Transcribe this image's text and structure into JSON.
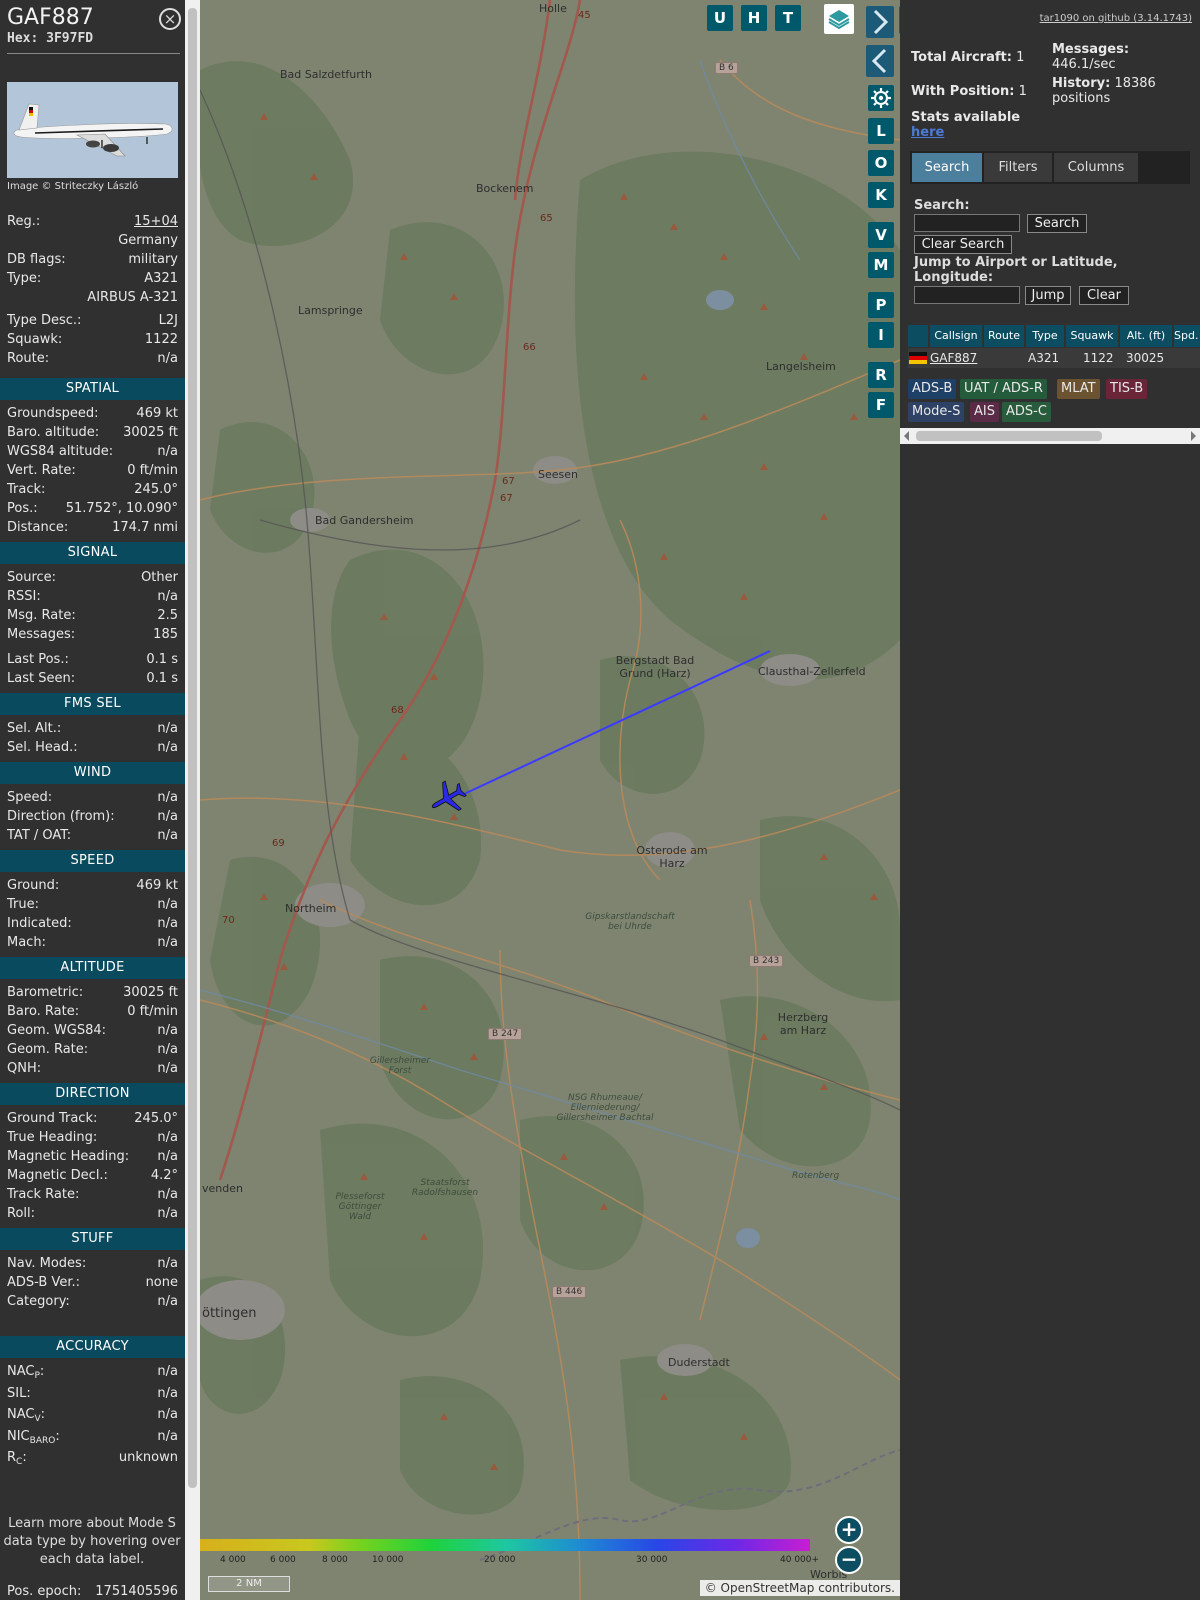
{
  "aircraft": {
    "callsign": "GAF887",
    "hex_label": "Hex:",
    "hex": "3F97FD",
    "photo_caption": "Image © Striteczky László",
    "rows": [
      {
        "label": "Reg.:",
        "value": "15+04",
        "link": true
      },
      {
        "label": "",
        "value": "Germany"
      },
      {
        "label": "DB flags:",
        "value": "military"
      },
      {
        "label": "Type:",
        "value": "A321"
      },
      {
        "label": "",
        "value": "AIRBUS A-321"
      },
      {
        "label": "Type Desc.:",
        "value": "L2J"
      },
      {
        "label": "Squawk:",
        "value": "1122"
      },
      {
        "label": "Route:",
        "value": "n/a"
      }
    ],
    "sections": [
      {
        "title": "SPATIAL",
        "rows": [
          {
            "label": "Groundspeed:",
            "value": "469 kt"
          },
          {
            "label": "Baro. altitude:",
            "value": "30025 ft"
          },
          {
            "label": "WGS84 altitude:",
            "value": "n/a"
          },
          {
            "label": "Vert. Rate:",
            "value": "0 ft/min"
          },
          {
            "label": "Track:",
            "value": "245.0°"
          },
          {
            "label": "Pos.:",
            "value": "51.752°, 10.090°"
          },
          {
            "label": "Distance:",
            "value": "174.7 nmi"
          }
        ]
      },
      {
        "title": "SIGNAL",
        "rows": [
          {
            "label": "Source:",
            "value": "Other"
          },
          {
            "label": "RSSI:",
            "value": "n/a"
          },
          {
            "label": "Msg. Rate:",
            "value": "2.5"
          },
          {
            "label": "Messages:",
            "value": "185"
          },
          {
            "label": "Last Pos.:",
            "value": "0.1 s"
          },
          {
            "label": "Last Seen:",
            "value": "0.1 s"
          }
        ]
      },
      {
        "title": "FMS SEL",
        "rows": [
          {
            "label": "Sel. Alt.:",
            "value": "n/a"
          },
          {
            "label": "Sel. Head.:",
            "value": "n/a"
          }
        ]
      },
      {
        "title": "WIND",
        "rows": [
          {
            "label": "Speed:",
            "value": "n/a"
          },
          {
            "label": "Direction (from):",
            "value": "n/a"
          },
          {
            "label": "TAT / OAT:",
            "value": "n/a"
          }
        ]
      },
      {
        "title": "SPEED",
        "rows": [
          {
            "label": "Ground:",
            "value": "469 kt"
          },
          {
            "label": "True:",
            "value": "n/a"
          },
          {
            "label": "Indicated:",
            "value": "n/a"
          },
          {
            "label": "Mach:",
            "value": "n/a"
          }
        ]
      },
      {
        "title": "ALTITUDE",
        "rows": [
          {
            "label": "Barometric:",
            "value": "30025 ft"
          },
          {
            "label": "Baro. Rate:",
            "value": "0 ft/min"
          },
          {
            "label": "Geom. WGS84:",
            "value": "n/a"
          },
          {
            "label": "Geom. Rate:",
            "value": "n/a"
          },
          {
            "label": "QNH:",
            "value": "n/a"
          }
        ]
      },
      {
        "title": "DIRECTION",
        "rows": [
          {
            "label": "Ground Track:",
            "value": "245.0°"
          },
          {
            "label": "True Heading:",
            "value": "n/a"
          },
          {
            "label": "Magnetic Heading:",
            "value": "n/a"
          },
          {
            "label": "Magnetic Decl.:",
            "value": "4.2°"
          },
          {
            "label": "Track Rate:",
            "value": "n/a"
          },
          {
            "label": "Roll:",
            "value": "n/a"
          }
        ]
      },
      {
        "title": "STUFF",
        "rows": [
          {
            "label": "Nav. Modes:",
            "value": "n/a"
          },
          {
            "label": "ADS-B Ver.:",
            "value": "none"
          },
          {
            "label": "Category:",
            "value": "n/a"
          }
        ]
      },
      {
        "title": "ACCURACY",
        "rows": [
          {
            "label": "NAC",
            "sub": "P",
            "suffix": ":",
            "value": "n/a"
          },
          {
            "label": "SIL:",
            "value": "n/a"
          },
          {
            "label": "NAC",
            "sub": "V",
            "suffix": ":",
            "value": "n/a"
          },
          {
            "label": "NIC",
            "sub": "BARO",
            "suffix": ":",
            "value": "n/a"
          },
          {
            "label": "R",
            "sub": "C",
            "suffix": ":",
            "value": "unknown"
          }
        ]
      }
    ],
    "learn_more": "Learn more about Mode S data type by hovering over each data label.",
    "pos_epoch_label": "Pos. epoch:",
    "pos_epoch": "1751405596"
  },
  "map": {
    "top_buttons": [
      "U",
      "H",
      "T"
    ],
    "side_buttons": [
      "L",
      "O",
      "K",
      "V",
      "M",
      "P",
      "I",
      "R",
      "F"
    ],
    "places": [
      {
        "name": "Holle"
      },
      {
        "name": "Bad Salzdetfurth"
      },
      {
        "name": "Bockenem"
      },
      {
        "name": "Lamspringe"
      },
      {
        "name": "Langelsheim"
      },
      {
        "name": "Seesen"
      },
      {
        "name": "Bad Gandersheim"
      },
      {
        "name": "Bergstadt Bad Grund (Harz)"
      },
      {
        "name": "Clausthal-Zellerfeld"
      },
      {
        "name": "Osterode am Harz"
      },
      {
        "name": "Northeim"
      },
      {
        "name": "Herzberg am Harz"
      },
      {
        "name": "Duderstadt"
      },
      {
        "name": "öttingen"
      },
      {
        "name": "venden"
      },
      {
        "name": "Worbis"
      }
    ],
    "nature_labels": [
      {
        "name": "Gipskarstlandschaft bei Uhrde"
      },
      {
        "name": "Gillersheimer Forst"
      },
      {
        "name": "NSG Rhumeaue/ Ellerniederung/ Gillersheimer Bachtal"
      },
      {
        "name": "Staatsforst Radolfshausen"
      },
      {
        "name": "Plesseforst Göttinger Wald"
      },
      {
        "name": "Rotenberg"
      }
    ],
    "road_numbers": [
      "45",
      "65",
      "66",
      "67",
      "67",
      "68",
      "69",
      "70"
    ],
    "road_badges": [
      "B 6",
      "B 243",
      "B 247",
      "B 446"
    ],
    "altitude_ticks": [
      "4 000",
      "6 000",
      "8 000",
      "10 000",
      "20 000",
      "30 000",
      "40 000+"
    ],
    "scale_label": "2 NM",
    "attribution_prefix": "©",
    "attribution_link": "OpenStreetMap",
    "attribution_suffix": "contributors.",
    "zoom_in": "+",
    "zoom_out": "−",
    "track_color": "#3b3bff",
    "aircraft_color": "#2a2ae6"
  },
  "panel": {
    "github": "tar1090 on github (3.14.1743)",
    "total_aircraft_label": "Total Aircraft:",
    "total_aircraft": "1",
    "with_position_label": "With Position:",
    "with_position": "1",
    "messages_label": "Messages:",
    "messages": "446.1/sec",
    "history_label": "History:",
    "history": "18386 positions",
    "stats_text": "Stats available",
    "stats_link": "here",
    "tabs": [
      "Search",
      "Filters",
      "Columns"
    ],
    "search_label": "Search:",
    "search_button": "Search",
    "clear_search_button": "Clear Search",
    "jump_label": "Jump to Airport or Latitude, Longitude:",
    "jump_button": "Jump",
    "clear_button": "Clear",
    "columns": [
      "Callsign",
      "Route",
      "Type",
      "Squawk",
      "Alt. (ft)",
      "Spd."
    ],
    "row": {
      "callsign": "GAF887",
      "route": "",
      "type": "A321",
      "squawk": "1122",
      "alt": "30025"
    },
    "sources": [
      {
        "label": "ADS-B",
        "bg": "#1e3f66",
        "fg": "#e8e8e8"
      },
      {
        "label": "UAT / ADS-R",
        "bg": "#245b3a",
        "fg": "#e8e8e8"
      },
      {
        "label": "MLAT",
        "bg": "#6b5230",
        "fg": "#e8e8e8"
      },
      {
        "label": "TIS-B",
        "bg": "#6a2638",
        "fg": "#e8e8e8"
      },
      {
        "label": "Mode-S",
        "bg": "#2e4266",
        "fg": "#e8e8e8"
      },
      {
        "label": "AIS",
        "bg": "#5a2a46",
        "fg": "#e8e8e8"
      },
      {
        "label": "ADS-C",
        "bg": "#285c3c",
        "fg": "#e8e8e8"
      }
    ]
  }
}
